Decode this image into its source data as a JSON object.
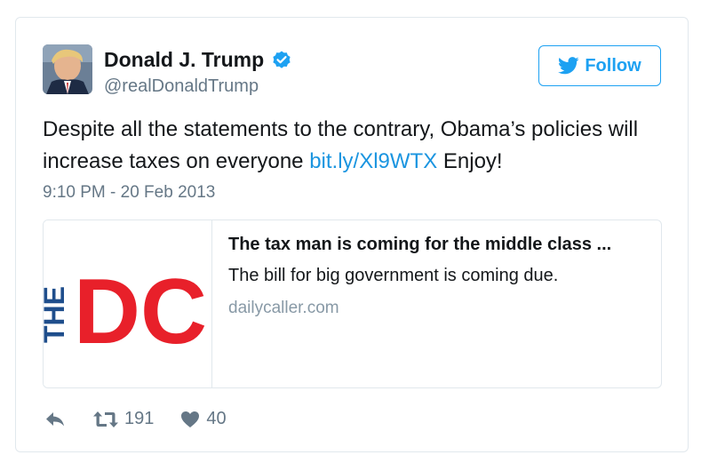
{
  "tweet": {
    "author": {
      "name": "Donald J. Trump",
      "handle": "@realDonaldTrump",
      "avatar_icon": "profile-photo",
      "verified_icon": "verified-badge-icon"
    },
    "follow_label": "Follow",
    "text_before_link": "Despite all the statements to the contrary, Obama’s policies will increase taxes on everyone ",
    "link_text": "bit.ly/Xl9WTX",
    "text_after_link": " Enjoy!",
    "timestamp": "9:10 PM - 20 Feb 2013",
    "card": {
      "logo_text_vertical": "THE",
      "logo_text": "DC",
      "title": "The tax man is coming for the middle class ...",
      "description": "The bill for big government is coming due.",
      "domain": "dailycaller.com"
    },
    "actions": {
      "reply_icon": "reply-icon",
      "retweet_icon": "retweet-icon",
      "retweet_count": "191",
      "like_icon": "heart-icon",
      "like_count": "40"
    }
  },
  "colors": {
    "accent": "#1da1f2",
    "link": "#1b95e0",
    "muted": "#657786",
    "logo_red": "#e8202a",
    "logo_blue": "#1f4e8c"
  }
}
